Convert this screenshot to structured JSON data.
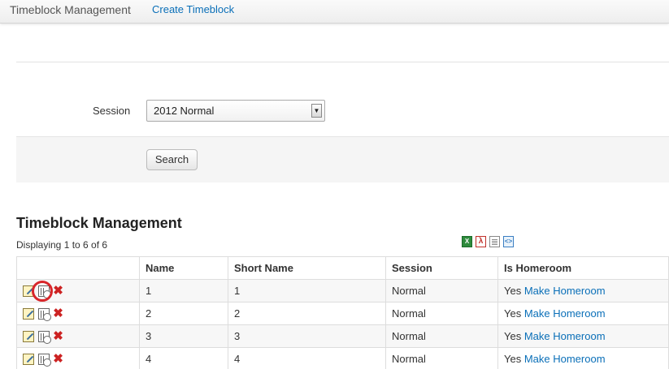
{
  "nav": {
    "title": "Timeblock Management",
    "create_link": "Create Timeblock"
  },
  "form": {
    "session_label": "Session",
    "session_value": "2012 Normal",
    "search_label": "Search"
  },
  "section": {
    "title": "Timeblock Management",
    "display_count": "Displaying 1 to 6 of 6"
  },
  "export_icons": [
    "excel-icon",
    "pdf-icon",
    "text-icon",
    "xml-icon"
  ],
  "table": {
    "headers": [
      "",
      "Name",
      "Short Name",
      "Session",
      "Is Homeroom"
    ],
    "rows": [
      {
        "name": "1",
        "short_name": "1",
        "session": "Normal",
        "is_homeroom": "Yes",
        "action": "Make Homeroom"
      },
      {
        "name": "2",
        "short_name": "2",
        "session": "Normal",
        "is_homeroom": "Yes",
        "action": "Make Homeroom"
      },
      {
        "name": "3",
        "short_name": "3",
        "session": "Normal",
        "is_homeroom": "Yes",
        "action": "Make Homeroom"
      },
      {
        "name": "4",
        "short_name": "4",
        "session": "Normal",
        "is_homeroom": "Yes",
        "action": "Make Homeroom"
      }
    ]
  },
  "colors": {
    "link": "#0a6fb8",
    "highlight_ring": "#d8262a",
    "delete": "#cc2222"
  }
}
